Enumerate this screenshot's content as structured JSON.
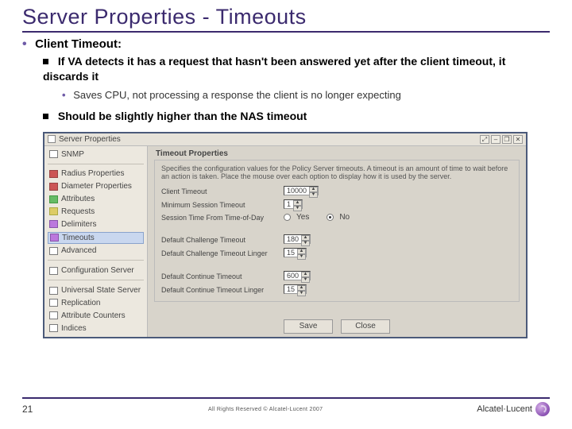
{
  "title": "Server Properties - Timeouts",
  "bullets": {
    "b1": "Client Timeout:",
    "b2a": "If VA detects it has a request that hasn't been answered yet after the client timeout, it discards it",
    "b3a": "Saves CPU, not processing a response the client is no longer expecting",
    "b2b": "Should be slightly higher than the NAS timeout"
  },
  "win": {
    "title": "Server Properties",
    "buttons": {
      "ext": "⤢",
      "min": "–",
      "max": "❐",
      "close": "✕"
    }
  },
  "sidebar": {
    "items": [
      {
        "label": "SNMP",
        "cls": ""
      },
      {
        "label": "Radius Properties",
        "cls": "red"
      },
      {
        "label": "Diameter Properties",
        "cls": "red"
      },
      {
        "label": "Attributes",
        "cls": "grn"
      },
      {
        "label": "Requests",
        "cls": "yel"
      },
      {
        "label": "Delimiters",
        "cls": "pur"
      },
      {
        "label": "Timeouts",
        "cls": "pur",
        "sel": true
      },
      {
        "label": "Advanced",
        "cls": ""
      },
      {
        "label": "Configuration Server",
        "cls": ""
      },
      {
        "label": "Universal State Server",
        "cls": ""
      },
      {
        "label": "Replication",
        "cls": ""
      },
      {
        "label": "Attribute Counters",
        "cls": ""
      },
      {
        "label": "Indices",
        "cls": ""
      }
    ]
  },
  "panel": {
    "group_title": "Timeout Properties",
    "description": "Specifies the configuration values for the Policy Server timeouts. A timeout is an amount of time to wait before an action is taken. Place the mouse over each option to display how it is used by the server.",
    "rows": {
      "client_timeout": {
        "label": "Client Timeout",
        "value": "10000"
      },
      "min_session": {
        "label": "Minimum Session Timeout",
        "value": "1"
      },
      "tod": {
        "label": "Session Time From Time-of-Day",
        "yes": "Yes",
        "no": "No",
        "selected": "no"
      },
      "chal_timeout": {
        "label": "Default Challenge Timeout",
        "value": "180"
      },
      "chal_linger": {
        "label": "Default Challenge Timeout Linger",
        "value": "15"
      },
      "cont_timeout": {
        "label": "Default Continue Timeout",
        "value": "600"
      },
      "cont_linger": {
        "label": "Default Continue Timeout Linger",
        "value": "15"
      }
    },
    "save": "Save",
    "close": "Close"
  },
  "footer": {
    "page": "21",
    "copyright": "All Rights Reserved © Alcatel-Lucent 2007",
    "brand": "Alcatel·Lucent"
  }
}
